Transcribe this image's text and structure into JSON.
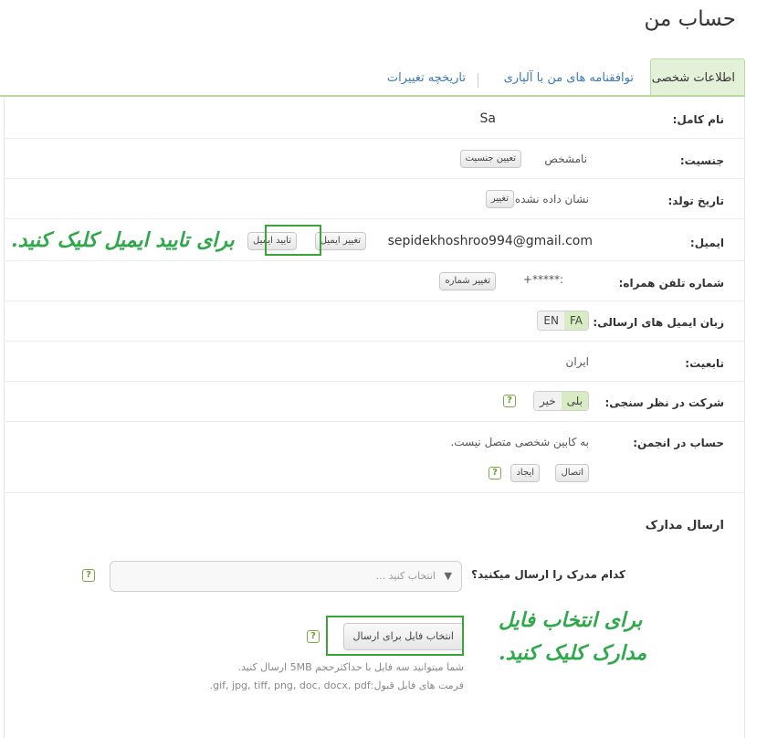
{
  "page": {
    "title": "حساب من"
  },
  "tabs": [
    {
      "label": "اطلاعات شخصی"
    },
    {
      "label": "توافقنامه های من با آلپاری"
    },
    {
      "label": "تاریخچه تغییرات"
    }
  ],
  "profile": {
    "fullname": {
      "label": "نام کامل:",
      "value": "Sa"
    },
    "gender": {
      "label": "جنسیت:",
      "value": "نامشخص",
      "button": "تعیین جنسیت"
    },
    "birthdate": {
      "label": "تاریخ تولد:",
      "value": "نشان داده نشده",
      "button": "تغییر"
    },
    "email": {
      "label": "ایمیل:",
      "value": "sepidekhoshroo994@gmail.com",
      "change_button": "تغییر ایمیل",
      "verify_button": "تایید ایمیل"
    },
    "phone": {
      "label": "شماره تلفن همراه:",
      "value": "+*****:",
      "button": "تغییر شماره"
    },
    "email_language": {
      "label": "زبان ایمیل های ارسالی:",
      "options": [
        "EN",
        "FA"
      ],
      "selected": "FA"
    },
    "citizenship": {
      "label": "تابعیت:",
      "value": "ایران"
    },
    "survey": {
      "label": "شرکت در نظر سنجی:",
      "options": [
        "خیر",
        "بلی"
      ],
      "selected": "بلی"
    },
    "forum": {
      "label": "حساب در انجمن:",
      "value": "به کابین شخصی متصل نیست.",
      "connect_button": "اتصال",
      "create_button": "ایجاد"
    }
  },
  "documents": {
    "title": "ارسال مدارک",
    "question_label": "کدام مدرک را ارسال میکنید؟",
    "select_placeholder": "انتخاب کنید ...",
    "upload_button": "انتخاب فایل برای ارسال",
    "size_note": "شما میتوانید سه فایل با حداکثرحجم 5MB ارسال کنید.",
    "format_note": "فرمت های فایل قبول:gif, jpg, tiff, png, doc, docx, pdf."
  },
  "annotations": {
    "email_hint": "برای تایید ایمیل کلیک کنید.",
    "file_hint_line1": "برای انتخاب فایل",
    "file_hint_line2": "مدارک کلیک کنید."
  },
  "icons": {
    "help": "help-icon",
    "dropdown": "dropdown-arrow-icon"
  },
  "colors": {
    "accent_green": "#3aa43a",
    "tab_active_bg": "#e4f1d9",
    "link_blue": "#3a7ab8"
  }
}
